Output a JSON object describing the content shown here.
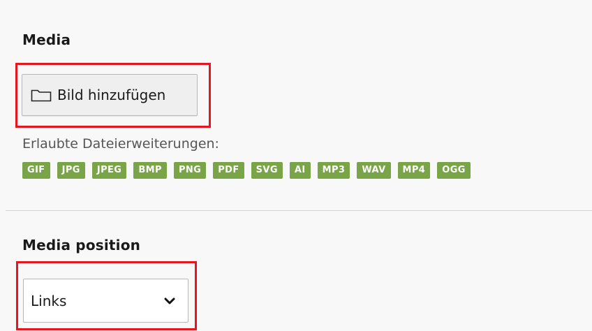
{
  "media": {
    "title": "Media",
    "add_button_label": "Bild hinzufügen",
    "allowed_label": "Erlaubte Dateierweiterungen:",
    "extensions": [
      "GIF",
      "JPG",
      "JPEG",
      "BMP",
      "PNG",
      "PDF",
      "SVG",
      "AI",
      "MP3",
      "WAV",
      "MP4",
      "OGG"
    ],
    "extension_badge_color": "#79a548"
  },
  "media_position": {
    "title": "Media position",
    "selected": "Links"
  },
  "highlight_color": "#e5161f",
  "icons": {
    "add_button": "folder-icon",
    "select": "chevron-down-icon"
  }
}
